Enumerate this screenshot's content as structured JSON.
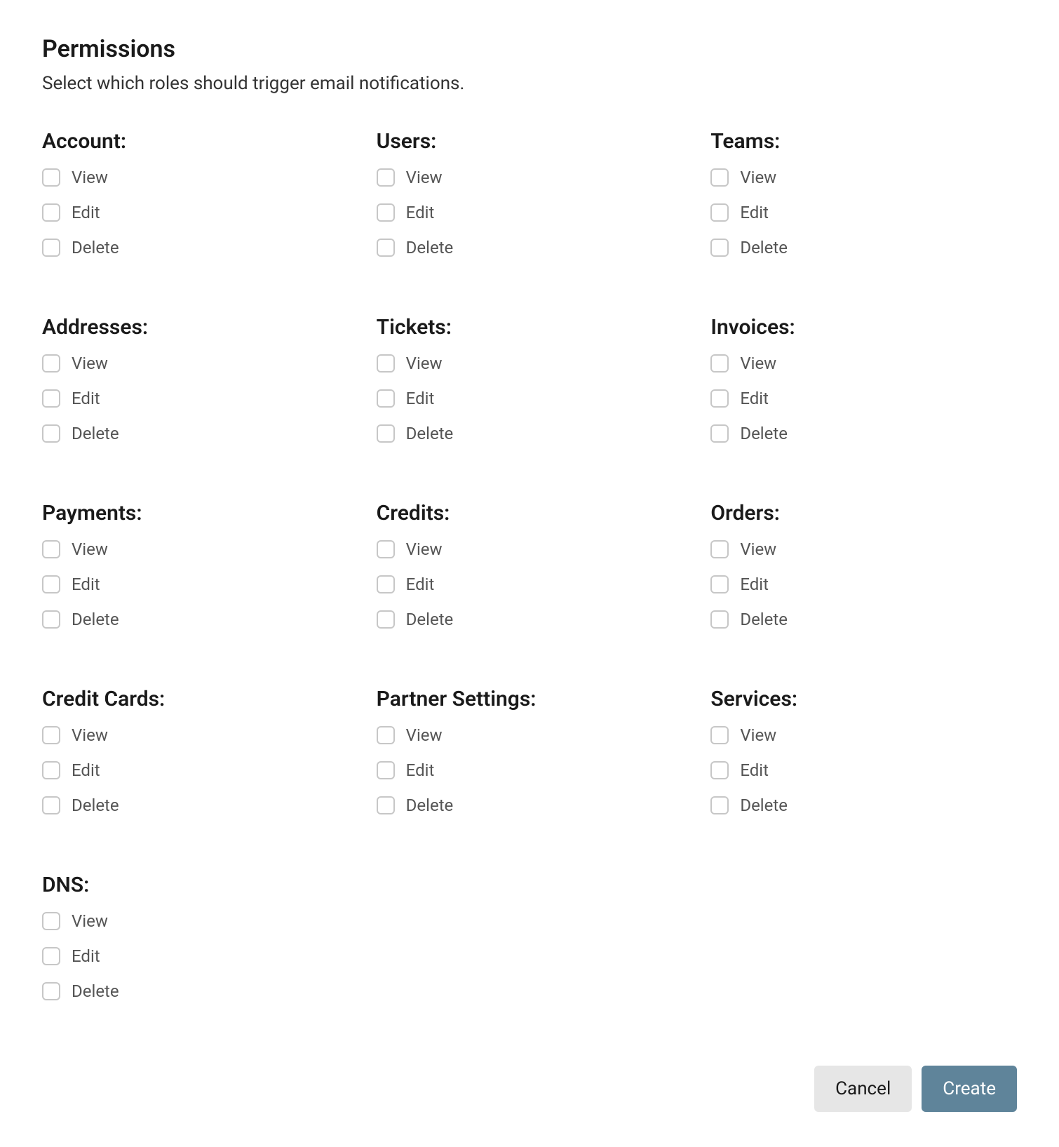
{
  "header": {
    "title": "Permissions",
    "subtitle": "Select which roles should trigger email notifications."
  },
  "groups": [
    {
      "key": "account",
      "title": "Account:",
      "options": [
        "View",
        "Edit",
        "Delete"
      ]
    },
    {
      "key": "users",
      "title": "Users:",
      "options": [
        "View",
        "Edit",
        "Delete"
      ]
    },
    {
      "key": "teams",
      "title": "Teams:",
      "options": [
        "View",
        "Edit",
        "Delete"
      ]
    },
    {
      "key": "addresses",
      "title": "Addresses:",
      "options": [
        "View",
        "Edit",
        "Delete"
      ]
    },
    {
      "key": "tickets",
      "title": "Tickets:",
      "options": [
        "View",
        "Edit",
        "Delete"
      ]
    },
    {
      "key": "invoices",
      "title": "Invoices:",
      "options": [
        "View",
        "Edit",
        "Delete"
      ]
    },
    {
      "key": "payments",
      "title": "Payments:",
      "options": [
        "View",
        "Edit",
        "Delete"
      ]
    },
    {
      "key": "credits",
      "title": "Credits:",
      "options": [
        "View",
        "Edit",
        "Delete"
      ]
    },
    {
      "key": "orders",
      "title": "Orders:",
      "options": [
        "View",
        "Edit",
        "Delete"
      ]
    },
    {
      "key": "credit-cards",
      "title": "Credit Cards:",
      "options": [
        "View",
        "Edit",
        "Delete"
      ]
    },
    {
      "key": "partner-settings",
      "title": "Partner Settings:",
      "options": [
        "View",
        "Edit",
        "Delete"
      ]
    },
    {
      "key": "services",
      "title": "Services:",
      "options": [
        "View",
        "Edit",
        "Delete"
      ]
    },
    {
      "key": "dns",
      "title": "DNS:",
      "options": [
        "View",
        "Edit",
        "Delete"
      ]
    }
  ],
  "buttons": {
    "cancel": "Cancel",
    "create": "Create"
  }
}
